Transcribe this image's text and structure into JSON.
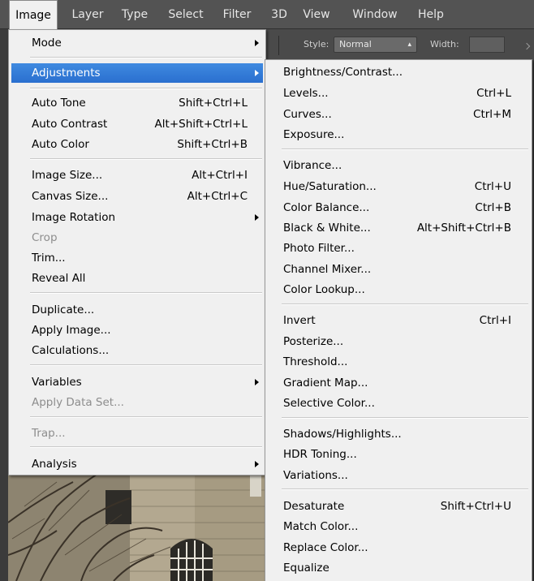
{
  "menubar": {
    "items": [
      {
        "label": "Image",
        "active": true
      },
      {
        "label": "Layer"
      },
      {
        "label": "Type"
      },
      {
        "label": "Select"
      },
      {
        "label": "Filter"
      },
      {
        "label": "3D"
      },
      {
        "label": "View"
      },
      {
        "label": "Window"
      },
      {
        "label": "Help"
      }
    ]
  },
  "options_bar": {
    "style_label": "Style:",
    "style_value": "Normal",
    "width_label": "Width:"
  },
  "image_menu": {
    "mode": "Mode",
    "adjustments": "Adjustments",
    "auto_tone": {
      "label": "Auto Tone",
      "shortcut": "Shift+Ctrl+L"
    },
    "auto_contrast": {
      "label": "Auto Contrast",
      "shortcut": "Alt+Shift+Ctrl+L"
    },
    "auto_color": {
      "label": "Auto Color",
      "shortcut": "Shift+Ctrl+B"
    },
    "image_size": {
      "label": "Image Size...",
      "shortcut": "Alt+Ctrl+I"
    },
    "canvas_size": {
      "label": "Canvas Size...",
      "shortcut": "Alt+Ctrl+C"
    },
    "image_rotation": "Image Rotation",
    "crop": "Crop",
    "trim": "Trim...",
    "reveal_all": "Reveal All",
    "duplicate": "Duplicate...",
    "apply_image": "Apply Image...",
    "calculations": "Calculations...",
    "variables": "Variables",
    "apply_data_set": "Apply Data Set...",
    "trap": "Trap...",
    "analysis": "Analysis"
  },
  "adjustments_menu": {
    "brightness_contrast": {
      "label": "Brightness/Contrast..."
    },
    "levels": {
      "label": "Levels...",
      "shortcut": "Ctrl+L"
    },
    "curves": {
      "label": "Curves...",
      "shortcut": "Ctrl+M"
    },
    "exposure": {
      "label": "Exposure..."
    },
    "vibrance": {
      "label": "Vibrance..."
    },
    "hue_saturation": {
      "label": "Hue/Saturation...",
      "shortcut": "Ctrl+U"
    },
    "color_balance": {
      "label": "Color Balance...",
      "shortcut": "Ctrl+B"
    },
    "black_white": {
      "label": "Black & White...",
      "shortcut": "Alt+Shift+Ctrl+B"
    },
    "photo_filter": {
      "label": "Photo Filter..."
    },
    "channel_mixer": {
      "label": "Channel Mixer..."
    },
    "color_lookup": {
      "label": "Color Lookup..."
    },
    "invert": {
      "label": "Invert",
      "shortcut": "Ctrl+I"
    },
    "posterize": {
      "label": "Posterize..."
    },
    "threshold": {
      "label": "Threshold..."
    },
    "gradient_map": {
      "label": "Gradient Map..."
    },
    "selective_color": {
      "label": "Selective Color..."
    },
    "shadows_highlights": {
      "label": "Shadows/Highlights..."
    },
    "hdr_toning": {
      "label": "HDR Toning..."
    },
    "variations": {
      "label": "Variations..."
    },
    "desaturate": {
      "label": "Desaturate",
      "shortcut": "Shift+Ctrl+U"
    },
    "match_color": {
      "label": "Match Color..."
    },
    "replace_color": {
      "label": "Replace Color..."
    },
    "equalize": {
      "label": "Equalize"
    }
  }
}
